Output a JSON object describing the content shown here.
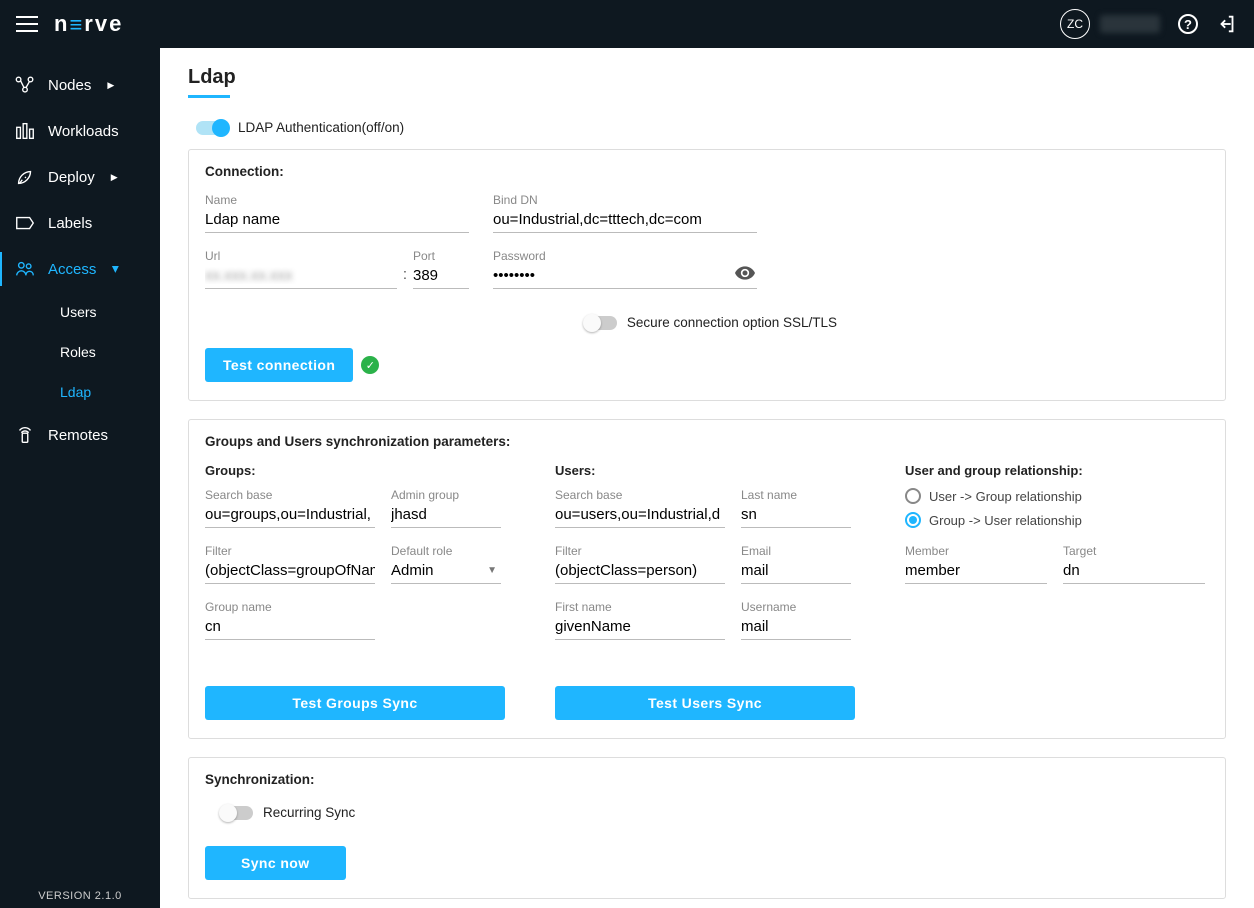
{
  "topbar": {
    "avatar_initials": "ZC"
  },
  "sidebar": {
    "items": [
      {
        "label": "Nodes"
      },
      {
        "label": "Workloads"
      },
      {
        "label": "Deploy"
      },
      {
        "label": "Labels"
      },
      {
        "label": "Access"
      },
      {
        "label": "Remotes"
      }
    ],
    "access_sub": {
      "users": "Users",
      "roles": "Roles",
      "ldap": "Ldap"
    },
    "version": "VERSION 2.1.0"
  },
  "page": {
    "title": "Ldap",
    "auth_toggle_label": "LDAP Authentication(off/on)"
  },
  "connection": {
    "title": "Connection:",
    "name_label": "Name",
    "name_value": "Ldap name",
    "url_label": "Url",
    "url_value": "xx.xxx.xx.xxx",
    "port_label": "Port",
    "port_value": "389",
    "binddn_label": "Bind DN",
    "binddn_value": "ou=Industrial,dc=tttech,dc=com",
    "password_label": "Password",
    "password_value": "••••••••",
    "secure_label": "Secure connection option SSL/TLS",
    "test_btn": "Test connection"
  },
  "sync_params": {
    "title": "Groups and Users synchronization parameters:",
    "groups": {
      "heading": "Groups:",
      "searchbase_label": "Search base",
      "searchbase_value": "ou=groups,ou=Industrial,",
      "admin_group_label": "Admin group",
      "admin_group_value": "jhasd",
      "filter_label": "Filter",
      "filter_value": "(objectClass=groupOfNam",
      "default_role_label": "Default role",
      "default_role_value": "Admin",
      "group_name_label": "Group name",
      "group_name_value": "cn",
      "test_btn": "Test Groups Sync"
    },
    "users": {
      "heading": "Users:",
      "searchbase_label": "Search base",
      "searchbase_value": "ou=users,ou=Industrial,d",
      "lastname_label": "Last name",
      "lastname_value": "sn",
      "filter_label": "Filter",
      "filter_value": "(objectClass=person)",
      "email_label": "Email",
      "email_value": "mail",
      "firstname_label": "First name",
      "firstname_value": "givenName",
      "username_label": "Username",
      "username_value": "mail",
      "test_btn": "Test Users Sync"
    },
    "relationship": {
      "heading": "User and group relationship:",
      "user_group": "User -> Group relationship",
      "group_user": "Group -> User relationship",
      "member_label": "Member",
      "member_value": "member",
      "target_label": "Target",
      "target_value": "dn"
    }
  },
  "synchronization": {
    "title": "Synchronization:",
    "recurring_label": "Recurring Sync",
    "sync_btn": "Sync now"
  }
}
